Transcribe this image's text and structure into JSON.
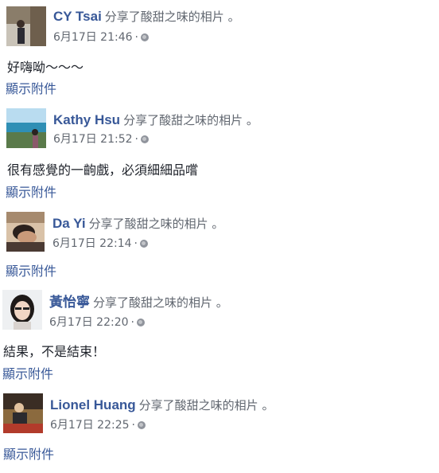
{
  "posts": [
    {
      "author": "CY Tsai",
      "action": "分享了酸甜之味的相片 。",
      "time": "6月17日 21:46",
      "body": "好嗨呦～～～",
      "attachment": "顯示附件"
    },
    {
      "author": "Kathy Hsu",
      "action": "分享了酸甜之味的相片 。",
      "time": "6月17日 21:52",
      "body": "很有感覺的一齣戲，必須細細品嚐",
      "attachment": "顯示附件"
    },
    {
      "author": "Da Yi",
      "action": "分享了酸甜之味的相片 。",
      "time": "6月17日 22:14",
      "body": "",
      "attachment": "顯示附件"
    },
    {
      "author": "黃怡寧",
      "action": "分享了酸甜之味的相片 。",
      "time": "6月17日 22:20",
      "body": "結果，不是結束！",
      "attachment": "顯示附件"
    },
    {
      "author": "Lionel Huang",
      "action": "分享了酸甜之味的相片 。",
      "time": "6月17日 22:25",
      "body": "",
      "attachment": "顯示附件"
    }
  ],
  "meta_separator": "·",
  "privacy_icon": "globe-icon",
  "colors": {
    "author_link": "#385898",
    "meta_text": "#616770"
  }
}
